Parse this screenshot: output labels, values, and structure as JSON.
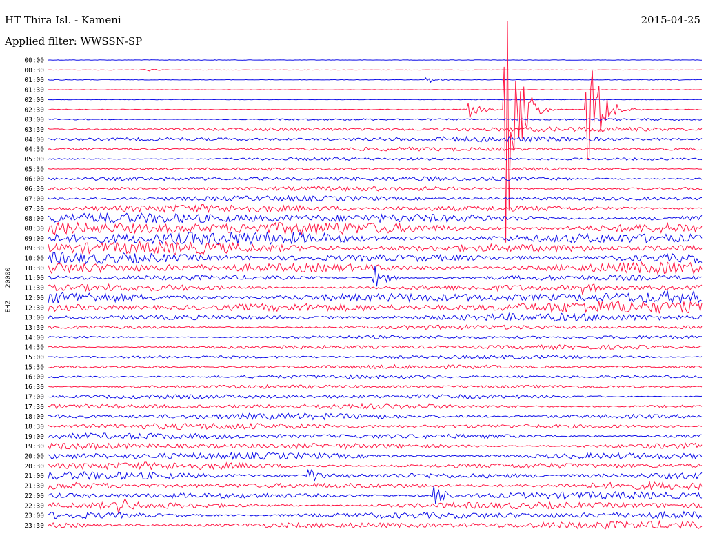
{
  "header": {
    "station": "HT Thira Isl. - Kameni",
    "filter": "Applied filter: WWSSN-SP",
    "date": "2015-04-25"
  },
  "chart_data": {
    "type": "line",
    "chart_kind": "helicorder",
    "ylabel": "EHZ - 20000",
    "row_labels": [
      "00:00",
      "00:30",
      "01:00",
      "01:30",
      "02:00",
      "02:30",
      "03:00",
      "03:30",
      "04:00",
      "04:30",
      "05:00",
      "05:30",
      "06:00",
      "06:30",
      "07:00",
      "07:30",
      "08:00",
      "08:30",
      "09:00",
      "09:30",
      "10:00",
      "10:30",
      "11:00",
      "11:30",
      "12:00",
      "12:30",
      "13:00",
      "13:30",
      "14:00",
      "14:30",
      "15:00",
      "15:30",
      "16:00",
      "16:30",
      "17:00",
      "17:30",
      "18:00",
      "18:30",
      "19:00",
      "19:30",
      "20:00",
      "20:30",
      "21:00",
      "21:30",
      "22:00",
      "22:30",
      "23:00",
      "23:30"
    ],
    "series_colors": [
      "#1010e8",
      "#ff1744"
    ],
    "row_noise_levels": [
      0.4,
      0.3,
      0.5,
      0.4,
      0.5,
      0.6,
      1.5,
      3.0,
      3.5,
      2.5,
      2.0,
      2.0,
      3.0,
      3.0,
      3.5,
      5.0,
      7.0,
      9.0,
      9.0,
      8.0,
      7.0,
      8.0,
      4.0,
      5.0,
      8.0,
      8.0,
      5.0,
      3.0,
      2.5,
      3.0,
      2.5,
      2.5,
      2.5,
      2.5,
      3.0,
      3.5,
      4.0,
      4.0,
      4.0,
      4.5,
      5.0,
      5.0,
      5.0,
      5.0,
      5.0,
      5.0,
      5.0,
      5.0
    ],
    "events": [
      {
        "row": 1,
        "x_fraction": 0.145,
        "amplitude": 3
      },
      {
        "row": 2,
        "x_fraction": 0.58,
        "amplitude": 5
      },
      {
        "row": 5,
        "x_fraction": 0.645,
        "amplitude": 12
      },
      {
        "row": 5,
        "x_fraction": 0.7,
        "amplitude": 200
      },
      {
        "row": 5,
        "x_fraction": 0.825,
        "amplitude": 120
      },
      {
        "row": 22,
        "x_fraction": 0.5,
        "amplitude": 20
      },
      {
        "row": 23,
        "x_fraction": 0.82,
        "amplitude": 15
      },
      {
        "row": 42,
        "x_fraction": 0.4,
        "amplitude": 12
      },
      {
        "row": 44,
        "x_fraction": 0.59,
        "amplitude": 18
      },
      {
        "row": 45,
        "x_fraction": 0.11,
        "amplitude": 14
      }
    ]
  }
}
